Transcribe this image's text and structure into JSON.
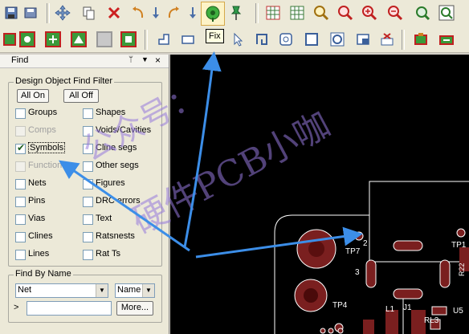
{
  "toolbar_top": {
    "tooltip": "Fix",
    "icons": [
      "floppy-save-icon",
      "move-icon",
      "copy-icon",
      "delete-icon",
      "undo-icon",
      "redo-icon",
      "down-arrow-icon",
      "down-arrow2-icon",
      "fix-icon",
      "pin-icon",
      "grid-icon",
      "grid2-icon",
      "zoom-fit-icon",
      "zoom-window-icon",
      "zoom-in-icon",
      "zoom-out-icon",
      "zoom-prev-icon",
      "zoom-world-icon"
    ]
  },
  "panel": {
    "title": "Find",
    "filter_group_label": "Design Object Find Filter",
    "all_on": "All On",
    "all_off": "All Off",
    "left_items": [
      {
        "label": "Groups",
        "checked": false,
        "disabled": false
      },
      {
        "label": "Comps",
        "checked": false,
        "disabled": true
      },
      {
        "label": "Symbols",
        "checked": true,
        "disabled": false
      },
      {
        "label": "Functions",
        "checked": false,
        "disabled": true
      },
      {
        "label": "Nets",
        "checked": false,
        "disabled": false
      },
      {
        "label": "Pins",
        "checked": false,
        "disabled": false
      },
      {
        "label": "Vias",
        "checked": false,
        "disabled": false
      },
      {
        "label": "Clines",
        "checked": false,
        "disabled": false
      },
      {
        "label": "Lines",
        "checked": false,
        "disabled": false
      }
    ],
    "right_items": [
      {
        "label": "Shapes",
        "checked": false
      },
      {
        "label": "Voids/Cavities",
        "checked": false
      },
      {
        "label": "Cline segs",
        "checked": false
      },
      {
        "label": "Other segs",
        "checked": false
      },
      {
        "label": "Figures",
        "checked": false
      },
      {
        "label": "DRC errors",
        "checked": false
      },
      {
        "label": "Text",
        "checked": false
      },
      {
        "label": "Ratsnests",
        "checked": false
      },
      {
        "label": "Rat Ts",
        "checked": false
      }
    ],
    "find_by_name": {
      "label": "Find By Name",
      "type_value": "Net",
      "mode_value": "Name",
      "prompt": ">",
      "input_value": "",
      "more": "More..."
    }
  },
  "canvas": {
    "labels": {
      "tp7": "TP7",
      "tp4": "TP4",
      "tp1": "TP1",
      "pin3": "3",
      "pin2": "2",
      "l1": "L1",
      "j1": "J1",
      "r13": "RL3",
      "r22": "R22",
      "u5": "U5"
    },
    "watermark_line1": "公众号：",
    "watermark_line2": "硬件PCB小咖",
    "colors": {
      "pad": "#7a1f1f",
      "outline": "#ffffff",
      "background": "#000000",
      "arrow": "#3c8ee8"
    }
  }
}
